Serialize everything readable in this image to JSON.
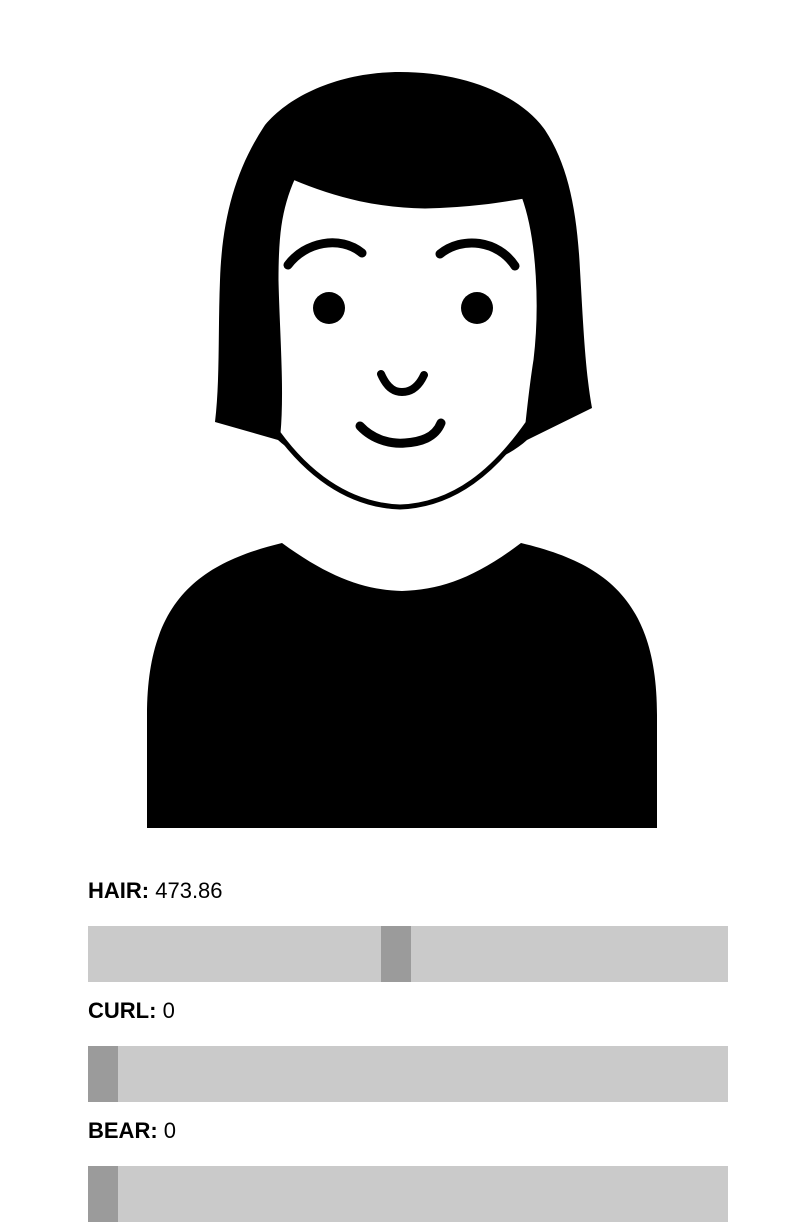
{
  "controls": [
    {
      "name": "HAIR:",
      "value": "473.86",
      "fraction": 0.481
    },
    {
      "name": "CURL:",
      "value": "0",
      "fraction": 0
    },
    {
      "name": "BEAR:",
      "value": "0",
      "fraction": 0
    }
  ],
  "colors": {
    "track": "#cacaca",
    "thumb": "#9b9b9b",
    "figure": "#000000",
    "background": "#ffffff"
  },
  "icons": {
    "avatar": "person-illustration"
  }
}
